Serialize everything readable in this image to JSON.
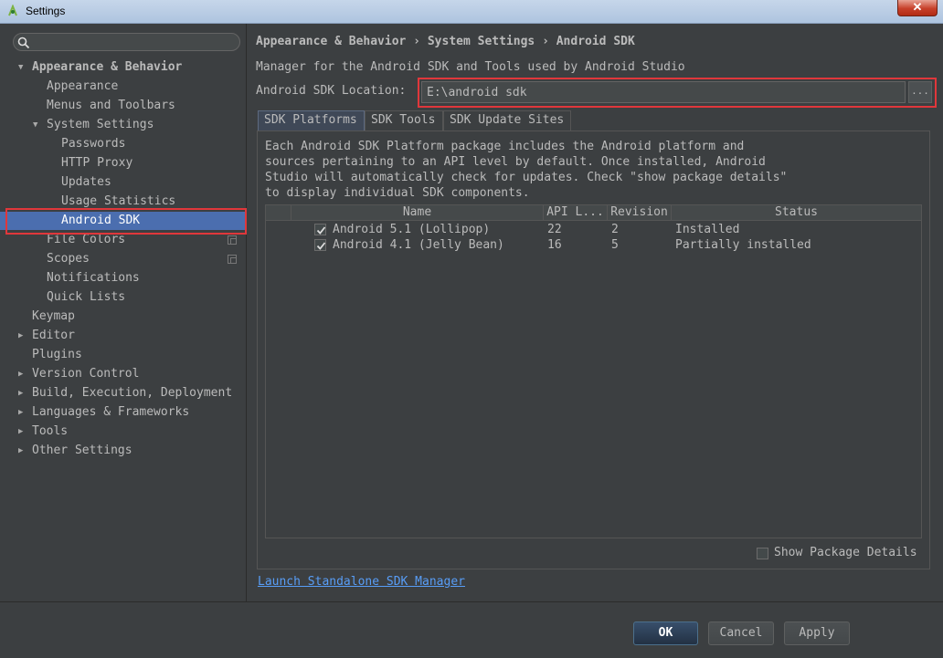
{
  "window": {
    "title": "Settings",
    "close_label": "✕"
  },
  "search": {
    "placeholder": ""
  },
  "tree": [
    {
      "label": "Appearance & Behavior",
      "level": 0,
      "expanded": true,
      "bold": true
    },
    {
      "label": "Appearance",
      "level": 1
    },
    {
      "label": "Menus and Toolbars",
      "level": 1
    },
    {
      "label": "System Settings",
      "level": 1,
      "expanded": true
    },
    {
      "label": "Passwords",
      "level": 2
    },
    {
      "label": "HTTP Proxy",
      "level": 2
    },
    {
      "label": "Updates",
      "level": 2
    },
    {
      "label": "Usage Statistics",
      "level": 2
    },
    {
      "label": "Android SDK",
      "level": 2,
      "selected": true
    },
    {
      "label": "File Colors",
      "level": 1,
      "copy_icon": true
    },
    {
      "label": "Scopes",
      "level": 1,
      "copy_icon": true
    },
    {
      "label": "Notifications",
      "level": 1
    },
    {
      "label": "Quick Lists",
      "level": 1
    },
    {
      "label": "Keymap",
      "level": 0
    },
    {
      "label": "Editor",
      "level": 0,
      "expanded": false
    },
    {
      "label": "Plugins",
      "level": 0
    },
    {
      "label": "Version Control",
      "level": 0,
      "expanded": false
    },
    {
      "label": "Build, Execution, Deployment",
      "level": 0,
      "expanded": false
    },
    {
      "label": "Languages & Frameworks",
      "level": 0,
      "expanded": false
    },
    {
      "label": "Tools",
      "level": 0,
      "expanded": false
    },
    {
      "label": "Other Settings",
      "level": 0,
      "expanded": false
    }
  ],
  "main": {
    "breadcrumb": "Appearance & Behavior › System Settings › Android SDK",
    "description": "Manager for the Android SDK and Tools used by Android Studio",
    "location_label": "Android SDK Location:",
    "location_value": "E:\\android sdk",
    "browse_label": "...",
    "tabs": [
      {
        "label": "SDK Platforms",
        "active": true
      },
      {
        "label": "SDK Tools"
      },
      {
        "label": "SDK Update Sites"
      }
    ],
    "platform_description": "Each Android SDK Platform package includes the Android platform and\nsources pertaining to an API level by default. Once installed, Android\nStudio will automatically check for updates. Check \"show package details\"\nto display individual SDK components.",
    "table": {
      "columns": [
        "Name",
        "API L...",
        "Revision",
        "Status"
      ],
      "rows": [
        {
          "checked": true,
          "name": "Android 5.1 (Lollipop)",
          "api": "22",
          "revision": "2",
          "status": "Installed"
        },
        {
          "checked": true,
          "name": "Android 4.1 (Jelly Bean)",
          "api": "16",
          "revision": "5",
          "status": "Partially installed"
        }
      ]
    },
    "show_package_details": "Show Package Details",
    "launch_link": "Launch Standalone SDK Manager"
  },
  "buttons": {
    "ok": "OK",
    "cancel": "Cancel",
    "apply": "Apply"
  },
  "colors": {
    "selection": "#4b6eaf",
    "highlight": "#e0373b",
    "link": "#589df6"
  }
}
